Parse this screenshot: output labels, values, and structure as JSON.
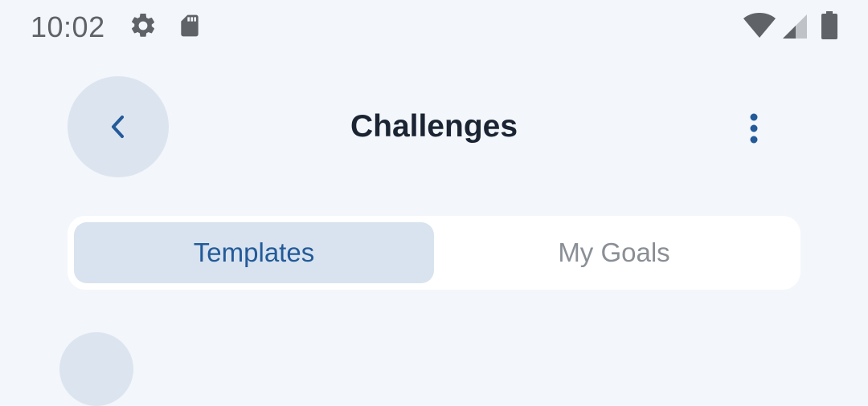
{
  "status_bar": {
    "time": "10:02",
    "icons": [
      "gear-icon",
      "sd-card-icon",
      "wifi-icon",
      "cell-signal-icon",
      "battery-icon"
    ]
  },
  "header": {
    "title": "Challenges",
    "back_icon": "chevron-left-icon",
    "more_icon": "more-vertical-icon"
  },
  "tabs": [
    {
      "label": "Templates",
      "selected": true
    },
    {
      "label": "My Goals",
      "selected": false
    }
  ],
  "colors": {
    "background": "#f3f6fa",
    "accent": "#235a99",
    "button_bg": "#dce5ef",
    "title": "#1b2433"
  }
}
